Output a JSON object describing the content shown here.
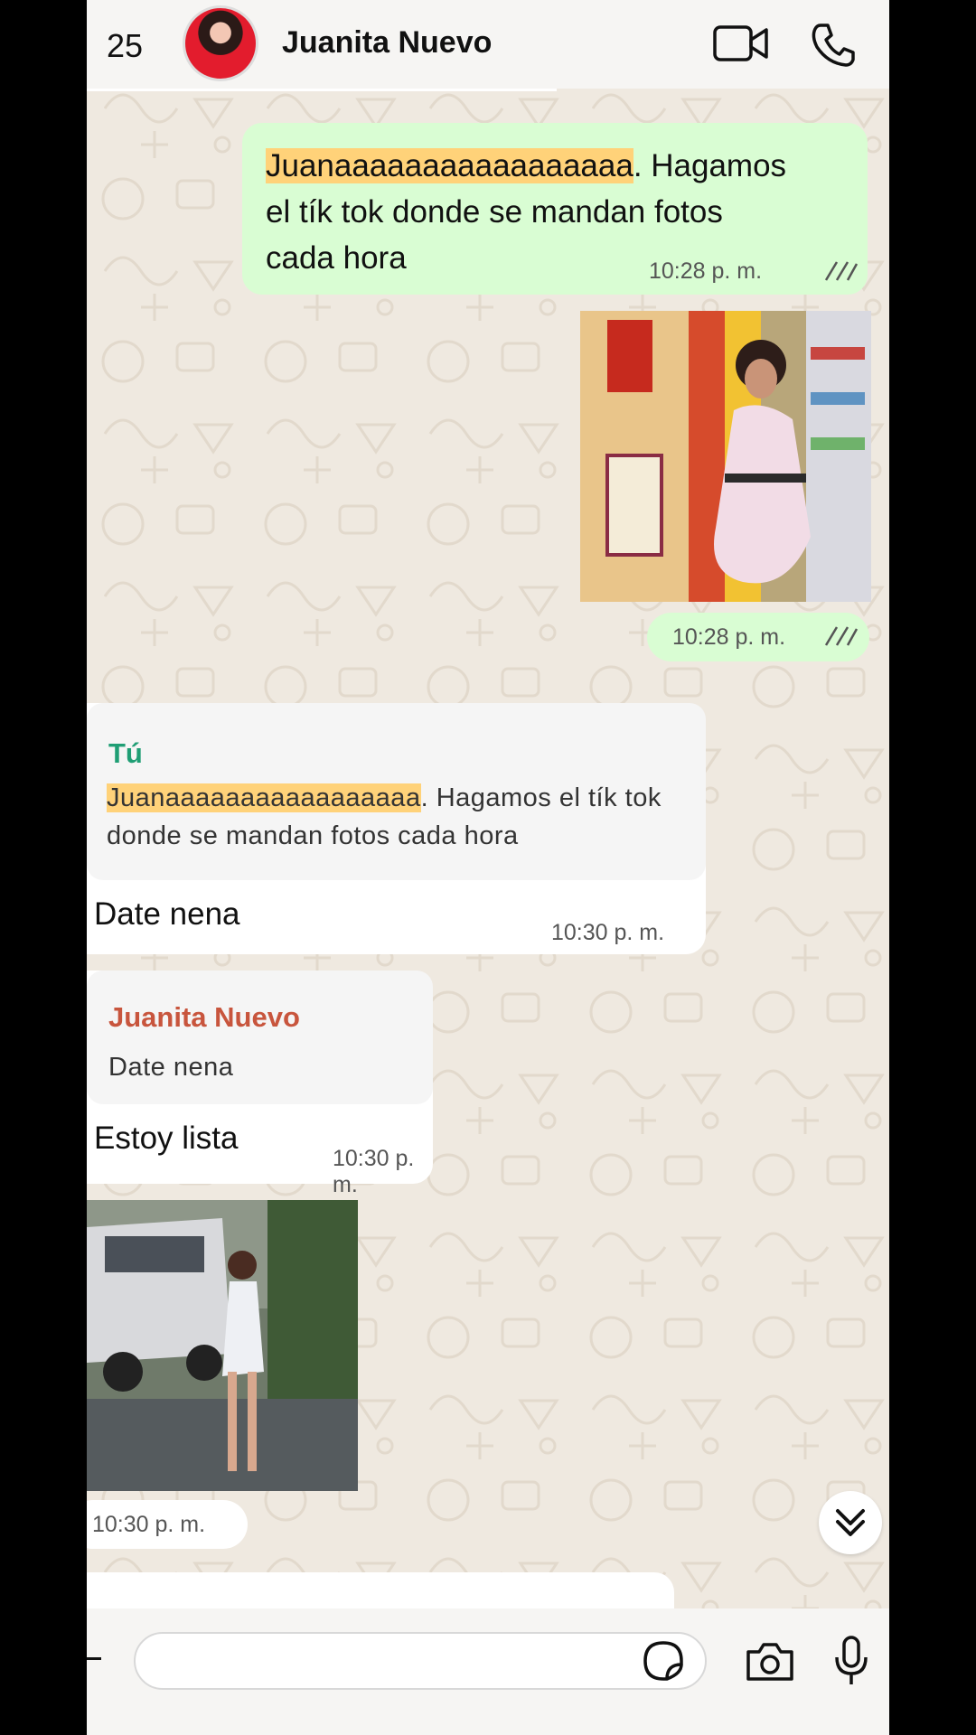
{
  "header": {
    "back_count": "25",
    "contact_name": "Juanita Nuevo"
  },
  "messages": {
    "m1": {
      "highlight": "Juanaaaaaaaaaaaaaaaaa",
      "rest_line1": ". Hagamos",
      "line2": "el tík tok donde se mandan fotos",
      "line3": "cada hora",
      "time": "10:28 p. m."
    },
    "m2": {
      "time": "10:28 p. m."
    },
    "m3": {
      "quote_author": "Tú",
      "quote_highlight": "Juanaaaaaaaaaaaaaaaaa",
      "quote_rest": ". Hagamos el tík tok",
      "quote_line2": "donde se mandan fotos cada hora",
      "text": "Date nena",
      "time": "10:30 p. m."
    },
    "m4": {
      "quote_author": "Juanita Nuevo",
      "quote_text": "Date nena",
      "text": "Estoy lista",
      "time": "10:30 p. m."
    },
    "m5": {
      "time": "10:30 p. m."
    }
  },
  "colors": {
    "outgoing_bubble": "#d9fdd3",
    "incoming_bubble": "#ffffff",
    "highlight": "#ffd279",
    "quote_author_self": "#1f9e74",
    "quote_author_contact": "#c8553d",
    "read_ticks": "#53bdeb"
  },
  "icons": [
    "video-camera-icon",
    "phone-icon",
    "sticker-icon",
    "camera-icon",
    "microphone-icon",
    "double-chevron-down-icon",
    "double-check-icon"
  ]
}
